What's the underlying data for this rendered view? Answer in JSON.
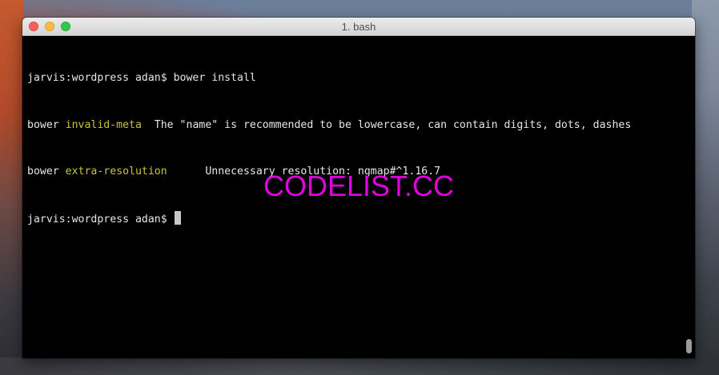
{
  "window": {
    "title": "1. bash"
  },
  "terminal": {
    "lines": [
      {
        "prompt": "jarvis:wordpress adan$",
        "command": " bower install"
      },
      {
        "prefix": "bower ",
        "tag": "invalid-meta",
        "message": "  The \"name\" is recommended to be lowercase, can contain digits, dots, dashes"
      },
      {
        "prefix": "bower ",
        "tag": "extra-resolution",
        "message": "      Unnecessary resolution: ngmap#^1.16.7"
      },
      {
        "prompt": "jarvis:wordpress adan$",
        "command": " "
      }
    ]
  },
  "watermark": "CODELIST.CC",
  "colors": {
    "terminal_bg": "#000000",
    "terminal_text": "#e6e6e6",
    "highlight": "#c7c43a",
    "watermark": "#e000e0",
    "close": "#fc605c",
    "minimize": "#fdbc40",
    "maximize": "#34c84a"
  }
}
